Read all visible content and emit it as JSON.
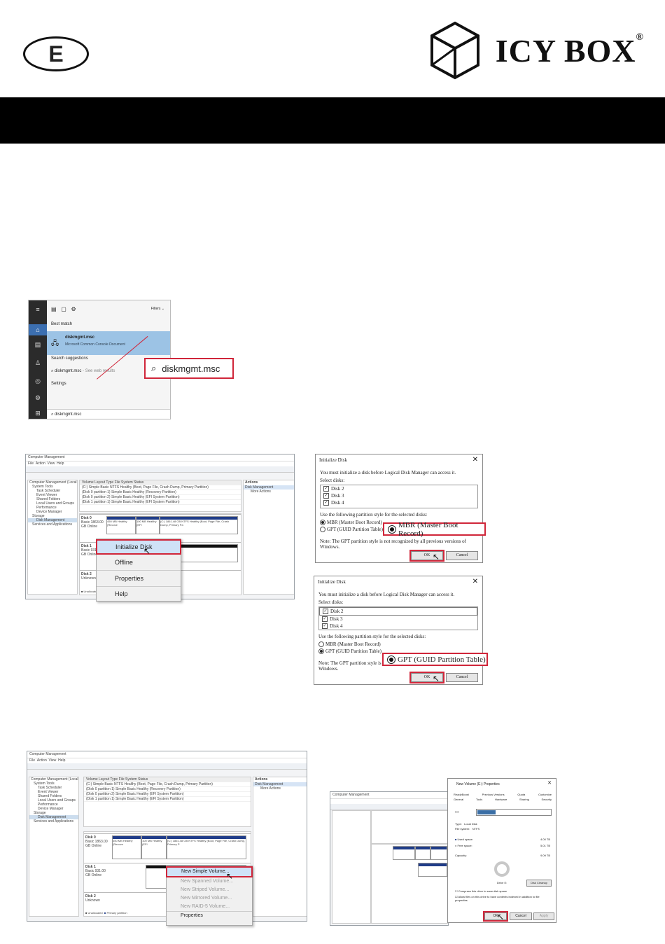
{
  "header": {
    "language_code": "E",
    "brand_name": "ICY BOX",
    "brand_mark": "®"
  },
  "search": {
    "filters_label": "Filters",
    "best_match_label": "Best match",
    "result_title": "diskmgmt.msc",
    "result_subtitle": "Microsoft Common Console Document",
    "suggestions_label": "Search suggestions",
    "suggestion_text": "diskmgmt.msc",
    "suggestion_hint": "- See web results",
    "settings_label": "Settings",
    "query": "diskmgmt.msc",
    "zoom_query": "diskmgmt.msc"
  },
  "cm1": {
    "title": "Computer Management",
    "menu": [
      "File",
      "Action",
      "View",
      "Help"
    ],
    "tree": [
      "Computer Management (Local",
      "System Tools",
      "Task Scheduler",
      "Event Viewer",
      "Shared Folders",
      "Local Users and Groups",
      "Performance",
      "Device Manager",
      "Storage",
      "Disk Management",
      "Services and Applications"
    ],
    "columns": "Volume   Layout   Type   File System   Status",
    "rows": [
      "(C:)   Simple  Basic  NTFS  Healthy (Boot, Page File, Crash Dump, Primary Partition)",
      "(Disk 0 partition 1)  Simple  Basic   Healthy (Recovery Partition)",
      "(Disk 0 partition 2)  Simple  Basic   Healthy (EFI System Partition)",
      "(Disk 1 partition 1)  Simple  Basic   Healthy (EFI System Partition)"
    ],
    "actions_header": "Actions",
    "actions_item": "Disk Management",
    "actions_more": "More Actions",
    "disk0_label": "Disk 0",
    "disk0_info": "Basic 1863.00 GB Online",
    "disk1_label": "Disk 1",
    "disk1_info": "Basic 931.00 GB Online",
    "disk2_label": "Disk 2",
    "disk2_info": "Unknown",
    "part_a": "450 MB Healthy (Recove",
    "part_b": "100 MB Healthy (EFI",
    "part_c": "(C:) 1861.48 GB NTFS Healthy (Boot, Page File, Crash Dump, Primary Pa",
    "legend": "Unallocated",
    "context_menu": [
      "Initialize Disk",
      "Offline",
      "Properties",
      "Help"
    ]
  },
  "dlg1": {
    "title": "Initialize Disk",
    "close": "✕",
    "instruction": "You must initialize a disk before Logical Disk Manager can access it.",
    "select_label": "Select disks:",
    "disks": [
      "Disk 2",
      "Disk 3",
      "Disk 4"
    ],
    "style_label": "Use the following partition style for the selected disks:",
    "mbr_label": "MBR (Master Boot Record)",
    "gpt_label": "GPT (GUID Partition Table)",
    "note": "Note: The GPT partition style is not recognized by all previous versions of Windows.",
    "ok": "OK",
    "cancel": "Cancel",
    "callout": "MBR (Master Boot Record)"
  },
  "dlg2": {
    "title": "Initialize Disk",
    "close": "✕",
    "instruction": "You must initialize a disk before Logical Disk Manager can access it.",
    "select_label": "Select disks:",
    "disks": [
      "Disk 2",
      "Disk 3",
      "Disk 4"
    ],
    "style_label": "Use the following partition style for the selected disks:",
    "mbr_label": "MBR (Master Boot Record)",
    "gpt_label": "GPT (GUID Partition Table)",
    "note": "Note: The GPT partition style is",
    "note2": "Windows.",
    "ok": "OK",
    "cancel": "Cancel",
    "callout": "GPT (GUID Partition Table)"
  },
  "cm2": {
    "title": "Computer Management",
    "menu": [
      "File",
      "Action",
      "View",
      "Help"
    ],
    "tree": [
      "Computer Management (Local",
      "System Tools",
      "Task Scheduler",
      "Event Viewer",
      "Shared Folders",
      "Local Users and Groups",
      "Performance",
      "Device Manager",
      "Storage",
      "Disk Management",
      "Services and Applications"
    ],
    "columns": "Volume   Layout   Type   File System   Status",
    "rows": [
      "(C:)   Simple  Basic  NTFS  Healthy (Boot, Page File, Crash Dump, Primary Partition)",
      "(Disk 0 partition 1)  Simple  Basic   Healthy (Recovery Partition)",
      "(Disk 0 partition 2)  Simple  Basic   Healthy (EFI System Partition)",
      "(Disk 1 partition 1)  Simple  Basic   Healthy (EFI System Partition)"
    ],
    "actions_header": "Actions",
    "actions_item": "Disk Management",
    "actions_more": "More Actions",
    "disk0_label": "Disk 0",
    "disk0_info": "Basic 1863.00 GB Online",
    "disk1_label": "Disk 1",
    "disk1_info": "Basic 931.00 GB Online",
    "disk2_label": "Disk 2",
    "disk2_info": "Unknown",
    "part_a": "450 MB Healthy (Recove",
    "part_b": "100 MB Healthy (EFI",
    "part_c": "(C:) 1861.48 GB NTFS Healthy (Boot, Page File, Crash Dump, Primary P",
    "legend_unalloc": "Unallocated",
    "legend_primary": "Primary partition",
    "context_menu": [
      "New Simple Volume...",
      "New Spanned Volume...",
      "New Striped Volume...",
      "New Mirrored Volume...",
      "New RAID-5 Volume...",
      "Properties"
    ]
  },
  "props": {
    "title": "New Volume (E:) Properties",
    "tabs_row1": [
      "ReadyBoost",
      "Previous Versions",
      "Quota",
      "Customize"
    ],
    "tabs_row2": [
      "General",
      "Tools",
      "Hardware",
      "Sharing",
      "Security"
    ],
    "type_label": "Type:",
    "type_value": "Local Disk",
    "fs_label": "File system:",
    "fs_value": "NTFS",
    "used_label": "Used space:",
    "used_value": "4.00 TB",
    "free_label": "Free space:",
    "free_value": "5.01 TB",
    "capacity_label": "Capacity:",
    "capacity_value": "9.09 TB",
    "drive_label": "Drive E:",
    "cleanup": "Disk Cleanup",
    "compress": "Compress this drive to save disk space",
    "index": "Allow files on this drive to have contents indexed in addition to file properties",
    "ok": "OK",
    "cancel": "Cancel",
    "apply": "Apply"
  },
  "colors": {
    "accent_red": "#d0263a",
    "partition_blue": "#1f3c88",
    "highlight_blue": "#9cc3e5"
  }
}
